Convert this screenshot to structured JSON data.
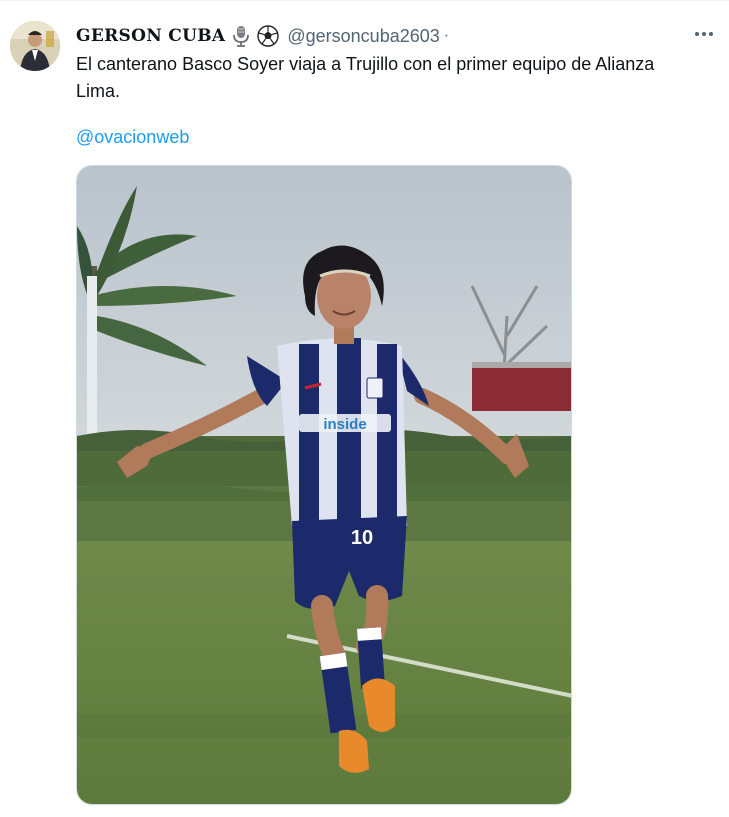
{
  "tweet": {
    "author_name": "GERSON CUBA",
    "author_emojis": [
      "microphone-icon",
      "soccer-ball-icon"
    ],
    "handle": "@gersoncuba2603",
    "separator": "·",
    "text": "El canterano Basco Soyer viaja a Trujillo con el primer equipo de Alianza\nLima.",
    "mention": "@ovacionweb",
    "more_icon": "more-icon",
    "media": {
      "kind": "photo",
      "jersey_sponsor": "inside",
      "jersey_number": "10"
    }
  },
  "colors": {
    "handle": "#536471",
    "link": "#1d9bf0",
    "text": "#0f1419",
    "jersey_navy": "#1c2a6b"
  }
}
